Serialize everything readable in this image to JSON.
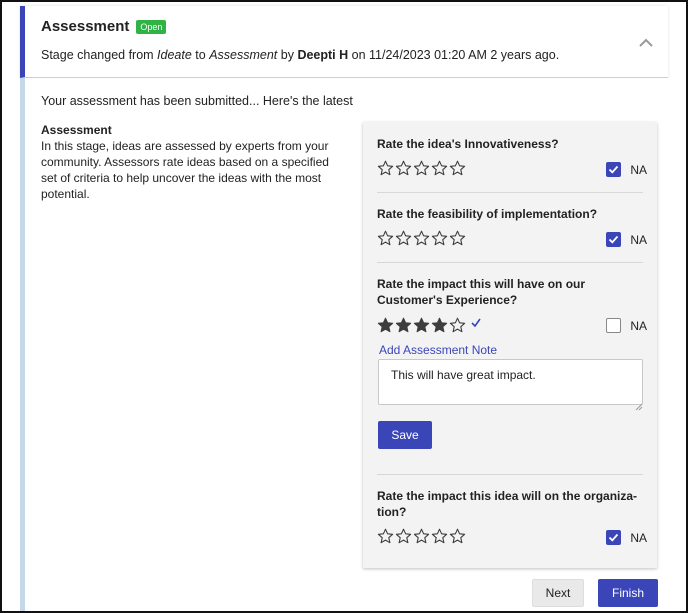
{
  "header": {
    "title": "Assessment",
    "badge": "Open",
    "stage_prefix": "Stage changed from ",
    "from_stage": "Ideate",
    "to_word": " to ",
    "to_stage": "Assessment",
    "by_word": " by ",
    "user": "Deepti H",
    "time_suffix": " on 11/24/2023 01:20 AM 2 years ago."
  },
  "body": {
    "submitted_text": "Your assessment has been submitted... Here's the latest",
    "description_title": "Assessment",
    "description_text": "In this stage, ideas are assessed by experts from your community. Assessors rate ideas based on a specified set of criteria to help uncover the ideas with the most potential."
  },
  "questions": [
    {
      "label": "Rate the idea's Innovativeness?",
      "rating": 0,
      "na_checked": true,
      "na_label": "NA"
    },
    {
      "label": "Rate the feasibility of implementation?",
      "rating": 0,
      "na_checked": true,
      "na_label": "NA"
    },
    {
      "label": "Rate the impact this will have on our Customer's Experience?",
      "rating": 4,
      "na_checked": false,
      "na_label": "NA"
    },
    {
      "label": "Rate the impact this idea will on the organiza-tion?",
      "rating": 0,
      "na_checked": true,
      "na_label": "NA"
    }
  ],
  "note": {
    "link_label": "Add Assessment Note",
    "value": "This will have great impact.",
    "save_label": "Save"
  },
  "footer": {
    "next_label": "Next",
    "finish_label": "Finish"
  },
  "colors": {
    "accent": "#3a46b8",
    "badge": "#2fb345",
    "side_bar": "#c4d8ea"
  },
  "icons": {
    "collapse": "chevron-up-icon",
    "star_empty": "star-outline-icon",
    "star_filled": "star-filled-icon",
    "check": "checkmark-icon"
  }
}
